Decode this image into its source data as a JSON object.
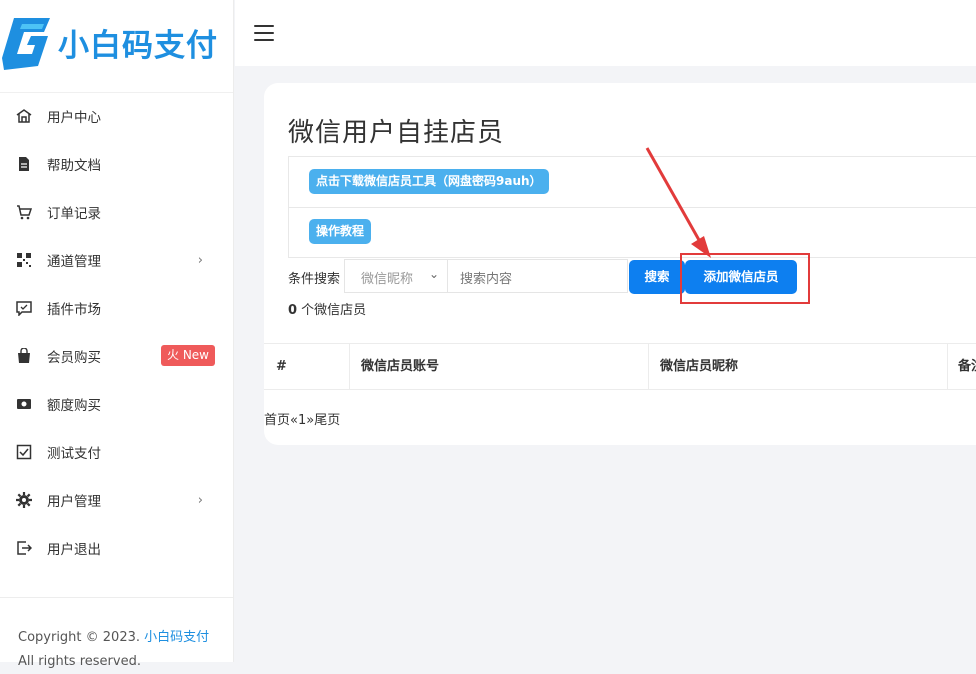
{
  "brand": {
    "name": "小白码支付",
    "logo_icon": "brand-logo-icon",
    "accent": "#1e8fe0"
  },
  "sidebar": {
    "items": [
      {
        "label": "用户中心",
        "icon": "home-icon"
      },
      {
        "label": "帮助文档",
        "icon": "document-icon"
      },
      {
        "label": "订单记录",
        "icon": "cart-icon"
      },
      {
        "label": "通道管理",
        "icon": "qrcode-icon",
        "chevron": "›"
      },
      {
        "label": "插件市场",
        "icon": "chat-icon"
      },
      {
        "label": "会员购买",
        "icon": "bag-icon",
        "badge": "火 New"
      },
      {
        "label": "额度购买",
        "icon": "money-icon"
      },
      {
        "label": "测试支付",
        "icon": "checkbox-icon"
      },
      {
        "label": "用户管理",
        "icon": "gear-icon",
        "chevron": "›"
      },
      {
        "label": "用户退出",
        "icon": "logout-icon"
      }
    ],
    "footer": {
      "copyright": "Copyright © 2023. ",
      "brand_link": "小白码支付",
      "rights": "All rights reserved."
    }
  },
  "main": {
    "title": "微信用户自挂店员",
    "download_button": "点击下载微信店员工具（网盘密码9auh）",
    "tutorial_button": "操作教程",
    "search": {
      "label": "条件搜索",
      "field_selected": "微信昵称",
      "placeholder": "搜索内容",
      "search_button": "搜索",
      "add_button": "添加微信店员"
    },
    "count": {
      "value": "0",
      "suffix": " 个微信店员"
    },
    "table": {
      "headers": [
        "#",
        "微信店员账号",
        "微信店员昵称",
        "备注"
      ]
    },
    "pagination": {
      "first": "首页",
      "prev": "«",
      "page": "1",
      "next": "»",
      "last": "尾页"
    }
  },
  "colors": {
    "primary": "#0d7ff0",
    "pill": "#4bb0ee",
    "badge": "#ef5a5a",
    "annotation": "#e23b3b"
  }
}
